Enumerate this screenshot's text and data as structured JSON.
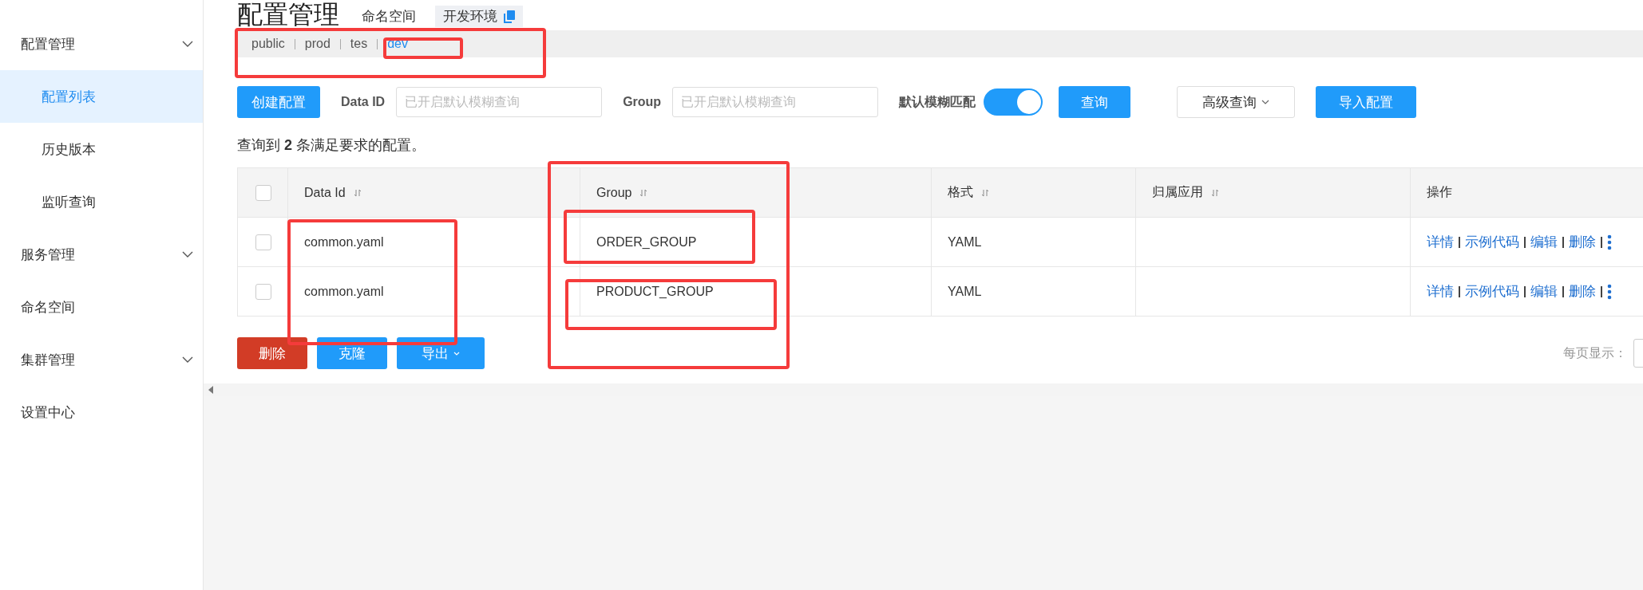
{
  "sidebar": {
    "items": [
      {
        "label": "配置管理",
        "kind": "group",
        "children": [
          {
            "label": "配置列表",
            "selected": true
          },
          {
            "label": "历史版本",
            "selected": false
          },
          {
            "label": "监听查询",
            "selected": false
          }
        ]
      },
      {
        "label": "服务管理",
        "kind": "group"
      },
      {
        "label": "命名空间",
        "kind": "link"
      },
      {
        "label": "集群管理",
        "kind": "group"
      },
      {
        "label": "设置中心",
        "kind": "link"
      }
    ]
  },
  "header": {
    "title": "配置管理",
    "namespace_label": "命名空间",
    "namespace_value": "开发环境"
  },
  "namespaces": [
    {
      "label": "public",
      "selected": false
    },
    {
      "label": "prod",
      "selected": false
    },
    {
      "label": "tes",
      "selected": false
    },
    {
      "label": "dev",
      "selected": true
    }
  ],
  "toolbar": {
    "create_button": "创建配置",
    "data_id": {
      "label": "Data ID",
      "placeholder": "已开启默认模糊查询"
    },
    "group": {
      "label": "Group",
      "placeholder": "已开启默认模糊查询"
    },
    "fuzzy": {
      "label": "默认模糊匹配",
      "on": true
    },
    "search_button": "查询",
    "advanced_button": "高级查询",
    "import_button": "导入配置"
  },
  "summary": "查询到 **2** 条满足要求的配置。",
  "table": {
    "all_checked": false,
    "columns": [
      {
        "label": "Data Id",
        "sortable": true
      },
      {
        "label": "Group",
        "sortable": true
      },
      {
        "label": "格式",
        "sortable": true
      },
      {
        "label": "归属应用",
        "sortable": true
      },
      {
        "label": "操作",
        "sortable": false
      }
    ],
    "rows": [
      {
        "checked": false,
        "data_id": "common.yaml",
        "group": "ORDER_GROUP",
        "format": "YAML",
        "actions": [
          "详情",
          "示例代码",
          "编辑",
          "删除"
        ]
      },
      {
        "checked": false,
        "data_id": "common.yaml",
        "group": "PRODUCT_GROUP",
        "format": "YAML",
        "actions": [
          "详情",
          "示例代码",
          "编辑",
          "删除"
        ]
      }
    ]
  },
  "bottom_buttons": [
    {
      "label": "删除",
      "kind": "danger"
    },
    {
      "label": "克隆",
      "kind": "primary"
    },
    {
      "label": "导出",
      "kind": "dropdown"
    }
  ],
  "pagination": {
    "label": "每页显示："
  }
}
